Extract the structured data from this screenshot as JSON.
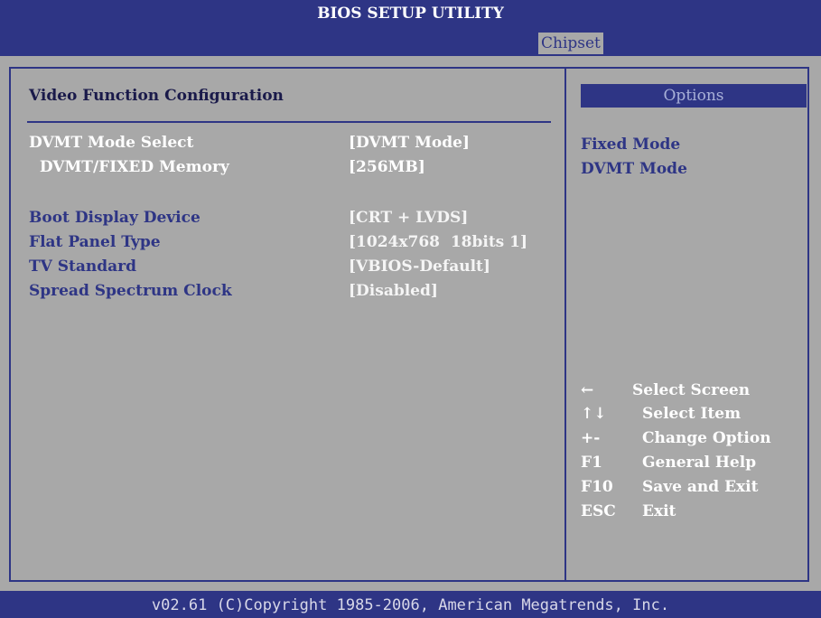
{
  "app": {
    "title": "BIOS SETUP UTILITY",
    "active_tab": "Chipset"
  },
  "section": {
    "title": "Video Function Configuration"
  },
  "settings": [
    {
      "label": "DVMT Mode Select",
      "value": "[DVMT Mode]"
    },
    {
      "label": "  DVMT/FIXED Memory",
      "value": "[256MB]"
    },
    {
      "label": "Boot Display Device",
      "value": "[CRT + LVDS]"
    },
    {
      "label": "Flat Panel Type",
      "value": "[1024x768  18bits 1]"
    },
    {
      "label": "TV Standard",
      "value": "[VBIOS-Default]"
    },
    {
      "label": "Spread Spectrum Clock",
      "value": "[Disabled]"
    }
  ],
  "options_panel": {
    "header": "Options",
    "items": [
      "Fixed Mode",
      "DVMT Mode"
    ]
  },
  "keys": [
    {
      "key": "←",
      "desc": "Select Screen"
    },
    {
      "key": "↑↓",
      "desc": "Select Item"
    },
    {
      "key": "+-",
      "desc": "Change Option"
    },
    {
      "key": "F1",
      "desc": "General Help"
    },
    {
      "key": "F10",
      "desc": "Save and Exit"
    },
    {
      "key": "ESC",
      "desc": "Exit"
    }
  ],
  "footer": {
    "text": "v02.61 (C)Copyright 1985-2006, American Megatrends, Inc."
  },
  "colors": {
    "background": "#a8a8a8",
    "accent": "#2e3585",
    "highlight": "#ffffff"
  }
}
